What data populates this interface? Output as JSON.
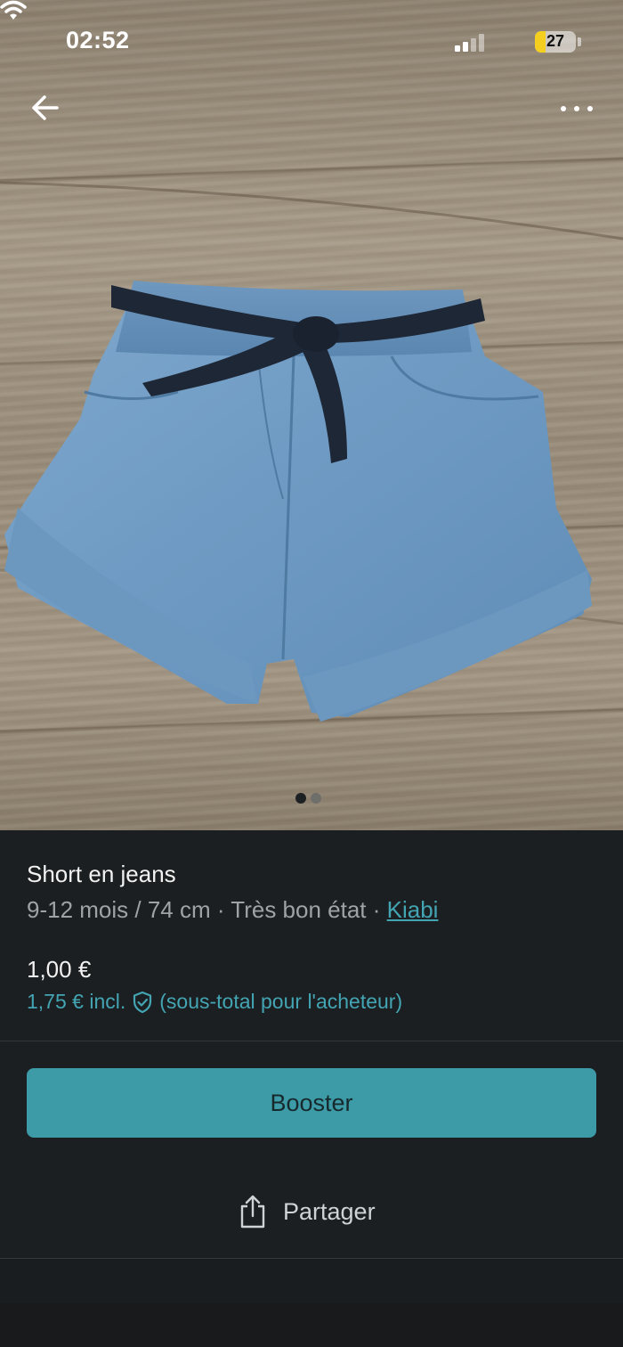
{
  "status_bar": {
    "time": "02:52",
    "battery_level": "27",
    "battery_color": "#f5cf1f"
  },
  "photo": {
    "description_icon": "denim-shorts-photo",
    "page_indicator": {
      "total": 2,
      "active": 1
    }
  },
  "header": {
    "back_icon": "arrow-left-icon",
    "more_icon": "more-horizontal-icon"
  },
  "item": {
    "title": "Short en jeans",
    "size": "9-12 mois / 74 cm",
    "separator1": " · ",
    "condition": "Très bon état",
    "separator2": " · ",
    "brand": "Kiabi",
    "price": "1,00 €",
    "price_incl": "1,75 € incl.",
    "price_incl_note": "(sous-total pour l'acheteur)"
  },
  "actions": {
    "boost_label": "Booster",
    "share_label": "Partager"
  },
  "colors": {
    "accent": "#3d9ba7",
    "link": "#43a5b3",
    "background": "#1c1f21"
  }
}
